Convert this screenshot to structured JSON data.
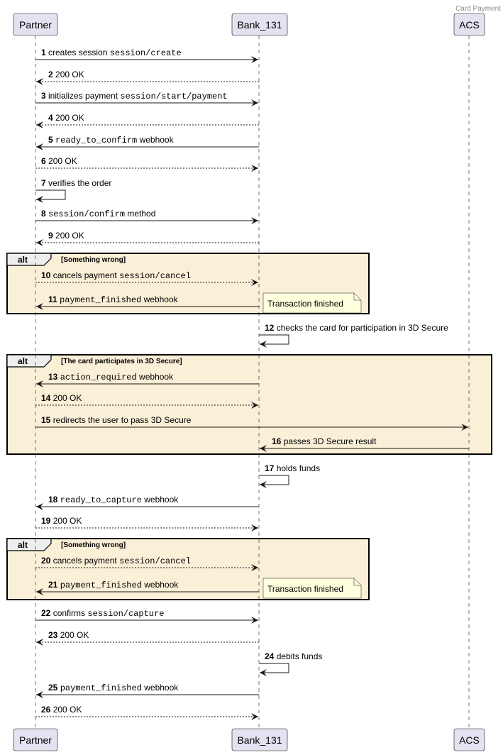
{
  "diagram": {
    "title": "Card Payment",
    "participants": [
      {
        "id": "partner",
        "label": "Partner"
      },
      {
        "id": "bank",
        "label": "Bank_131"
      },
      {
        "id": "acs",
        "label": "ACS"
      }
    ],
    "messages": [
      {
        "n": "1",
        "from": "partner",
        "to": "bank",
        "style": "solid",
        "parts": [
          {
            "t": "creates session "
          },
          {
            "t": "session/create",
            "mono": true
          }
        ]
      },
      {
        "n": "2",
        "from": "bank",
        "to": "partner",
        "style": "dashed",
        "parts": [
          {
            "t": "200 OK"
          }
        ]
      },
      {
        "n": "3",
        "from": "partner",
        "to": "bank",
        "style": "solid",
        "parts": [
          {
            "t": "initializes payment "
          },
          {
            "t": "session/start/payment",
            "mono": true
          }
        ]
      },
      {
        "n": "4",
        "from": "bank",
        "to": "partner",
        "style": "dashed",
        "parts": [
          {
            "t": "200 OK"
          }
        ]
      },
      {
        "n": "5",
        "from": "bank",
        "to": "partner",
        "style": "solid",
        "parts": [
          {
            "t": "ready_to_confirm",
            "mono": true
          },
          {
            "t": " webhook"
          }
        ]
      },
      {
        "n": "6",
        "from": "partner",
        "to": "bank",
        "style": "dashed",
        "parts": [
          {
            "t": "200 OK"
          }
        ]
      },
      {
        "n": "7",
        "from": "partner",
        "to": "partner",
        "style": "solid",
        "parts": [
          {
            "t": "verifies the order"
          }
        ]
      },
      {
        "n": "8",
        "from": "partner",
        "to": "bank",
        "style": "solid",
        "parts": [
          {
            "t": "session/confirm",
            "mono": true
          },
          {
            "t": " method"
          }
        ]
      },
      {
        "n": "9",
        "from": "bank",
        "to": "partner",
        "style": "dashed",
        "parts": [
          {
            "t": "200 OK"
          }
        ]
      },
      {
        "n": "10",
        "from": "partner",
        "to": "bank",
        "style": "dashed",
        "parts": [
          {
            "t": "cancels payment "
          },
          {
            "t": "session/cancel",
            "mono": true
          }
        ]
      },
      {
        "n": "11",
        "from": "bank",
        "to": "partner",
        "style": "solid",
        "parts": [
          {
            "t": "payment_finished",
            "mono": true
          },
          {
            "t": " webhook"
          }
        ],
        "note": "Transaction finished"
      },
      {
        "n": "12",
        "from": "bank",
        "to": "bank",
        "style": "solid",
        "parts": [
          {
            "t": "checks the card for participation in 3D Secure"
          }
        ]
      },
      {
        "n": "13",
        "from": "bank",
        "to": "partner",
        "style": "solid",
        "parts": [
          {
            "t": "action_required",
            "mono": true
          },
          {
            "t": " webhook"
          }
        ]
      },
      {
        "n": "14",
        "from": "partner",
        "to": "bank",
        "style": "dashed",
        "parts": [
          {
            "t": "200 OK"
          }
        ]
      },
      {
        "n": "15",
        "from": "partner",
        "to": "acs",
        "style": "solid",
        "parts": [
          {
            "t": "redirects the user to pass 3D Secure"
          }
        ]
      },
      {
        "n": "16",
        "from": "acs",
        "to": "bank",
        "style": "solid",
        "parts": [
          {
            "t": "passes 3D Secure result"
          }
        ]
      },
      {
        "n": "17",
        "from": "bank",
        "to": "bank",
        "style": "solid",
        "parts": [
          {
            "t": "holds funds"
          }
        ]
      },
      {
        "n": "18",
        "from": "bank",
        "to": "partner",
        "style": "solid",
        "parts": [
          {
            "t": "ready_to_capture",
            "mono": true
          },
          {
            "t": " webhook"
          }
        ]
      },
      {
        "n": "19",
        "from": "partner",
        "to": "bank",
        "style": "dashed",
        "parts": [
          {
            "t": "200 OK"
          }
        ]
      },
      {
        "n": "20",
        "from": "partner",
        "to": "bank",
        "style": "dashed",
        "parts": [
          {
            "t": "cancels payment "
          },
          {
            "t": "session/cancel",
            "mono": true
          }
        ]
      },
      {
        "n": "21",
        "from": "bank",
        "to": "partner",
        "style": "solid",
        "parts": [
          {
            "t": "payment_finished",
            "mono": true
          },
          {
            "t": " webhook"
          }
        ],
        "note": "Transaction finished"
      },
      {
        "n": "22",
        "from": "partner",
        "to": "bank",
        "style": "solid",
        "parts": [
          {
            "t": "confirms "
          },
          {
            "t": "session/capture",
            "mono": true
          }
        ]
      },
      {
        "n": "23",
        "from": "bank",
        "to": "partner",
        "style": "dashed",
        "parts": [
          {
            "t": "200 OK"
          }
        ]
      },
      {
        "n": "24",
        "from": "bank",
        "to": "bank",
        "style": "solid",
        "parts": [
          {
            "t": "debits funds"
          }
        ]
      },
      {
        "n": "25",
        "from": "bank",
        "to": "partner",
        "style": "solid",
        "parts": [
          {
            "t": "payment_finished",
            "mono": true
          },
          {
            "t": " webhook"
          }
        ]
      },
      {
        "n": "26",
        "from": "partner",
        "to": "bank",
        "style": "dashed",
        "parts": [
          {
            "t": "200 OK"
          }
        ]
      }
    ],
    "fragments": [
      {
        "kind": "alt",
        "condition": "[Something wrong]",
        "first": "10",
        "last": "11"
      },
      {
        "kind": "alt",
        "condition": "[The card participates in 3D Secure]",
        "first": "13",
        "last": "16"
      },
      {
        "kind": "alt",
        "condition": "[Something wrong]",
        "first": "20",
        "last": "21"
      }
    ],
    "colors": {
      "participant_fill": "#E2E2F0",
      "participant_border": "#181818",
      "fragment_fill": "#FAEFD7",
      "note_fill": "#FEFFDD",
      "line": "#181818"
    }
  }
}
